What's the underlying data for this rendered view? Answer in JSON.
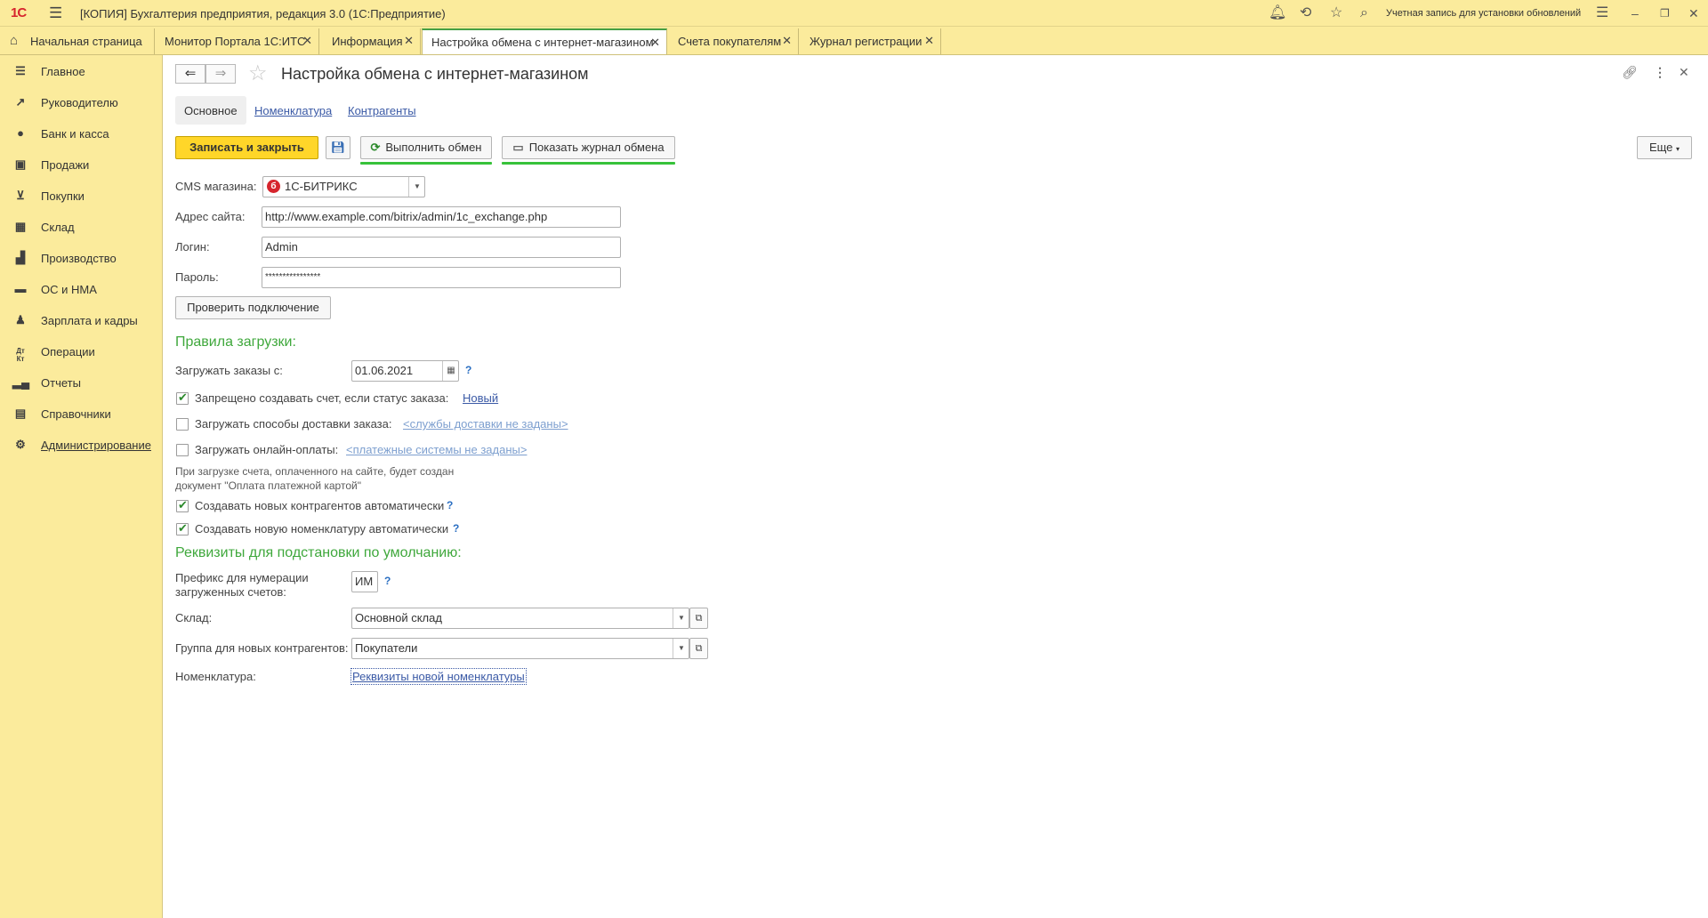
{
  "app": {
    "logo": "1С",
    "title": "[КОПИЯ] Бухгалтерия предприятия, редакция 3.0  (1С:Предприятие)",
    "account": "Учетная запись для установки обновлений"
  },
  "tabs": {
    "home": "Начальная страница",
    "items": [
      {
        "label": "Монитор Портала 1С:ИТС"
      },
      {
        "label": "Информация"
      },
      {
        "label": "Настройка обмена с интернет-магазином"
      },
      {
        "label": "Счета покупателям"
      },
      {
        "label": "Журнал регистрации"
      }
    ],
    "active_index": 2
  },
  "sidebar": {
    "items": [
      {
        "label": "Главное",
        "icon": "menu-icon"
      },
      {
        "label": "Руководителю",
        "icon": "trend-icon"
      },
      {
        "label": "Банк и касса",
        "icon": "coin-icon"
      },
      {
        "label": "Продажи",
        "icon": "bag-icon"
      },
      {
        "label": "Покупки",
        "icon": "cart-icon"
      },
      {
        "label": "Склад",
        "icon": "grid-icon"
      },
      {
        "label": "Производство",
        "icon": "factory-icon"
      },
      {
        "label": "ОС и НМА",
        "icon": "truck-icon"
      },
      {
        "label": "Зарплата и кадры",
        "icon": "person-icon"
      },
      {
        "label": "Операции",
        "icon": "dt-kt-icon"
      },
      {
        "label": "Отчеты",
        "icon": "bar-chart-icon"
      },
      {
        "label": "Справочники",
        "icon": "book-icon"
      },
      {
        "label": "Администрирование",
        "icon": "gear-icon"
      }
    ]
  },
  "form": {
    "title": "Настройка обмена с интернет-магазином",
    "subtabs": [
      "Основное",
      "Номенклатура",
      "Контрагенты"
    ],
    "toolbar": {
      "save_close": "Записать и закрыть",
      "run_exchange": "Выполнить обмен",
      "show_log": "Показать журнал обмена",
      "more": "Еще"
    },
    "cms_label": "CMS магазина:",
    "cms_value": "1С-БИТРИКС",
    "site_label": "Адрес сайта:",
    "site_value": "http://www.example.com/bitrix/admin/1c_exchange.php",
    "login_label": "Логин:",
    "login_value": "Admin",
    "password_label": "Пароль:",
    "password_value": "****************",
    "check_button": "Проверить подключение",
    "rules_header": "Правила загрузки:",
    "load_orders_label": "Загружать заказы с:",
    "load_orders_date": "01.06.2021",
    "forbid_label": "Запрещено создавать счет, если статус заказа:",
    "forbid_checked": true,
    "forbid_link": "Новый",
    "delivery_label": "Загружать способы доставки заказа:",
    "delivery_checked": false,
    "delivery_link": "<службы доставки не заданы>",
    "online_label": "Загружать онлайн-оплаты:",
    "online_checked": false,
    "online_link": "<платежные системы не заданы>",
    "note_line1": "При загрузке счета, оплаченного на сайте, будет создан",
    "note_line2": "документ \"Оплата платежной картой\"",
    "new_contractors_label": "Создавать новых контрагентов автоматически",
    "new_contractors_checked": true,
    "new_items_label": "Создавать новую номенклатуру автоматически",
    "new_items_checked": true,
    "defaults_header": "Реквизиты для подстановки по умолчанию:",
    "prefix_label_1": "Префикс для нумерации",
    "prefix_label_2": "загруженных счетов:",
    "prefix_value": "ИМ",
    "warehouse_label": "Склад:",
    "warehouse_value": "Основной склад",
    "group_label": "Группа для новых контрагентов:",
    "group_value": "Покупатели",
    "nomenclature_label": "Номенклатура:",
    "nomenclature_link": "Реквизиты новой номенклатуры",
    "help_mark": "?"
  },
  "colors": {
    "accent_yellow": "#ffd629",
    "panel_yellow": "#fbeb9c",
    "section_green": "#3fa83c",
    "link_blue": "#3b5aa6"
  }
}
